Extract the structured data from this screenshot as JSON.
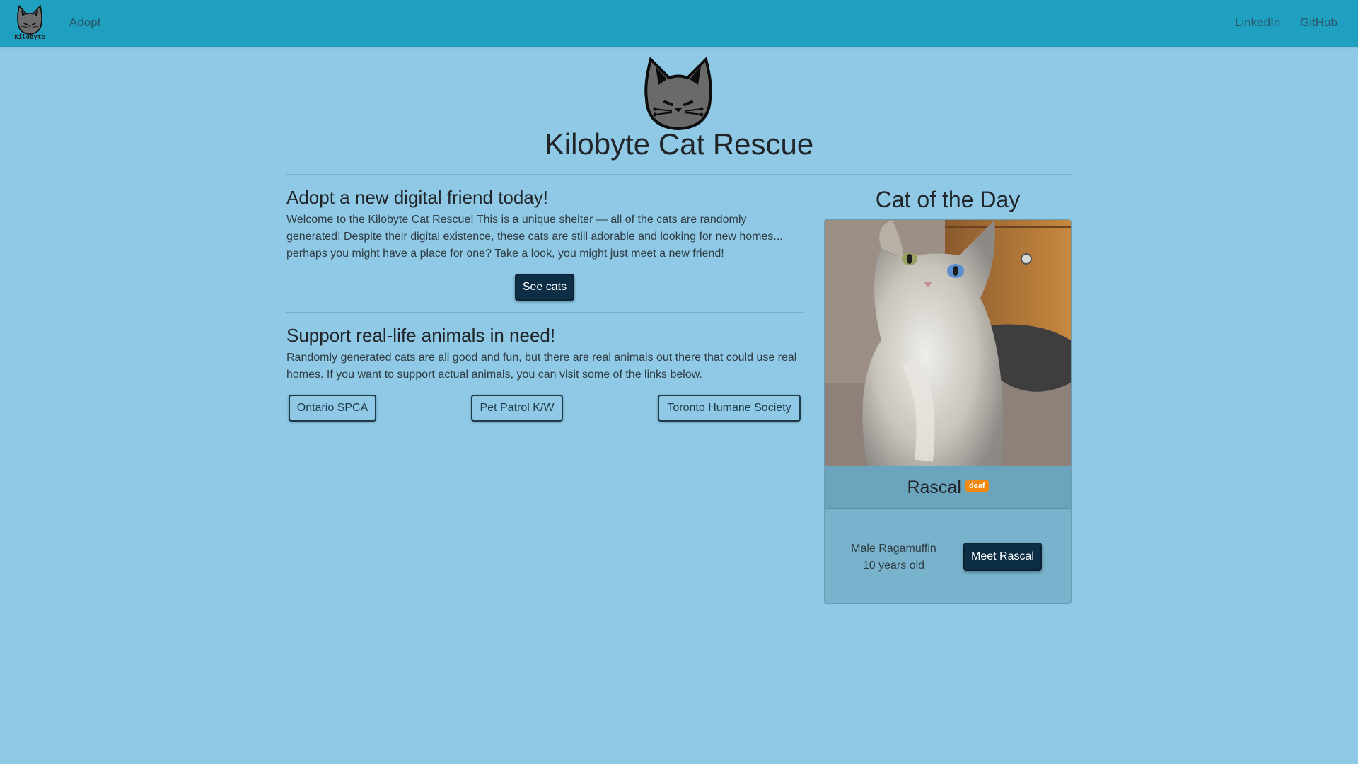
{
  "nav": {
    "brand_text": "Kilobyte",
    "adopt_label": "Adopt",
    "linkedin_label": "LinkedIn",
    "github_label": "GitHub",
    "bg_color": "#1fa0c0"
  },
  "page": {
    "bg_color": "#8fc9e5",
    "title": "Kilobyte Cat Rescue"
  },
  "adopt_section": {
    "heading": "Adopt a new digital friend today!",
    "body": "Welcome to the Kilobyte Cat Rescue! This is a unique shelter — all of the cats are randomly generated! Despite their digital existence, these cats are still adorable and looking for new homes... perhaps you might have a place for one? Take a look, you might just meet a new friend!",
    "button_label": "See cats"
  },
  "support_section": {
    "heading": "Support real-life animals in need!",
    "body": "Randomly generated cats are all good and fun, but there are real animals out there that could use real homes. If you want to support actual animals, you can visit some of the links below.",
    "links": [
      {
        "label": "Ontario SPCA"
      },
      {
        "label": "Pet Patrol K/W"
      },
      {
        "label": "Toronto Humane Society"
      }
    ]
  },
  "cat_of_the_day": {
    "heading": "Cat of the Day",
    "name": "Rascal",
    "badge": "deaf",
    "badge_color": "#f0890e",
    "description_line1": "Male Ragamuffin",
    "description_line2": "10 years old",
    "button_label": "Meet Rascal"
  },
  "icons": {
    "brand_logo": "cat-logo-icon",
    "hero_logo": "cat-logo-icon"
  }
}
